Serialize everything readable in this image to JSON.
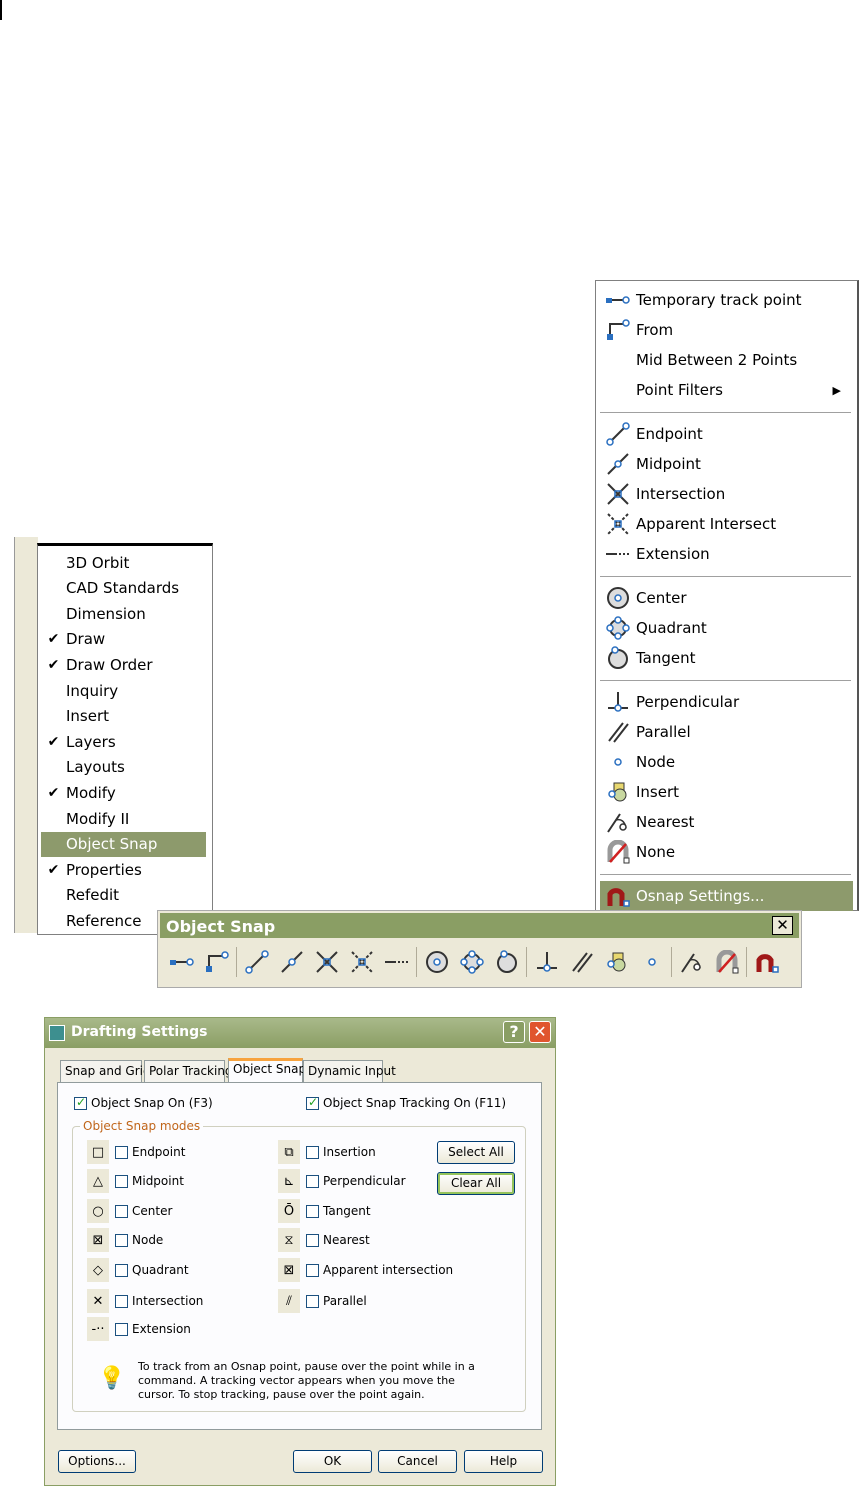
{
  "osnap_menu": {
    "items": [
      {
        "label": "Temporary track point",
        "icon": "temporary-track-point-icon"
      },
      {
        "label": "From",
        "icon": "from-icon"
      },
      {
        "label": "Mid Between 2 Points",
        "icon": ""
      },
      {
        "label": "Point Filters",
        "icon": "",
        "submenu": true
      },
      {
        "sep": true
      },
      {
        "label": "Endpoint",
        "icon": "endpoint-icon"
      },
      {
        "label": "Midpoint",
        "icon": "midpoint-icon"
      },
      {
        "label": "Intersection",
        "icon": "intersection-icon"
      },
      {
        "label": "Apparent Intersect",
        "icon": "apparent-intersect-icon"
      },
      {
        "label": "Extension",
        "icon": "extension-icon"
      },
      {
        "sep": true
      },
      {
        "label": "Center",
        "icon": "center-icon"
      },
      {
        "label": "Quadrant",
        "icon": "quadrant-icon"
      },
      {
        "label": "Tangent",
        "icon": "tangent-icon"
      },
      {
        "sep": true
      },
      {
        "label": "Perpendicular",
        "icon": "perpendicular-icon"
      },
      {
        "label": "Parallel",
        "icon": "parallel-icon"
      },
      {
        "label": "Node",
        "icon": "node-icon"
      },
      {
        "label": "Insert",
        "icon": "insert-icon"
      },
      {
        "label": "Nearest",
        "icon": "nearest-icon"
      },
      {
        "label": "None",
        "icon": "none-icon"
      },
      {
        "sep": true
      },
      {
        "label": "Osnap Settings...",
        "icon": "osnap-settings-icon",
        "highlighted": true
      }
    ]
  },
  "toolbar_menu": {
    "items": [
      {
        "label": "3D Orbit",
        "checked": false
      },
      {
        "label": "CAD Standards",
        "checked": false
      },
      {
        "label": "Dimension",
        "checked": false
      },
      {
        "label": "Draw",
        "checked": true
      },
      {
        "label": "Draw Order",
        "checked": true
      },
      {
        "label": "Inquiry",
        "checked": false
      },
      {
        "label": "Insert",
        "checked": false
      },
      {
        "label": "Layers",
        "checked": true
      },
      {
        "label": "Layouts",
        "checked": false
      },
      {
        "label": "Modify",
        "checked": true
      },
      {
        "label": "Modify II",
        "checked": false
      },
      {
        "label": "Object Snap",
        "checked": false,
        "highlighted": true
      },
      {
        "label": "Properties",
        "checked": true
      },
      {
        "label": "Refedit",
        "checked": false
      },
      {
        "label": "Reference",
        "checked": false
      }
    ]
  },
  "osnap_toolbar": {
    "title": "Object Snap",
    "close": "✕",
    "icons": [
      "temporary-track-point",
      "from",
      "|",
      "endpoint",
      "midpoint",
      "intersection",
      "apparent-intersect",
      "extension",
      "|",
      "center",
      "quadrant",
      "tangent",
      "|",
      "perpendicular",
      "parallel",
      "insert",
      "node",
      "|",
      "nearest",
      "none",
      "|",
      "osnap-settings"
    ]
  },
  "dialog": {
    "title": "Drafting Settings",
    "help": "?",
    "close": "✕",
    "tabs": [
      {
        "label": "Snap and Grid"
      },
      {
        "label": "Polar Tracking"
      },
      {
        "label": "Object Snap",
        "active": true
      },
      {
        "label": "Dynamic Input"
      }
    ],
    "osnap_on": {
      "label": "Object Snap On (F3)",
      "checked": true
    },
    "tracking_on": {
      "label": "Object Snap Tracking On (F11)",
      "checked": true
    },
    "group_label": "Object Snap modes",
    "modes_left": [
      {
        "label": "Endpoint",
        "glyph": "□"
      },
      {
        "label": "Midpoint",
        "glyph": "△"
      },
      {
        "label": "Center",
        "glyph": "○"
      },
      {
        "label": "Node",
        "glyph": "⊠"
      },
      {
        "label": "Quadrant",
        "glyph": "◇"
      },
      {
        "label": "Intersection",
        "glyph": "✕"
      },
      {
        "label": "Extension",
        "glyph": "-··"
      }
    ],
    "modes_right": [
      {
        "label": "Insertion",
        "glyph": "⧉"
      },
      {
        "label": "Perpendicular",
        "glyph": "⊾"
      },
      {
        "label": "Tangent",
        "glyph": "Ō"
      },
      {
        "label": "Nearest",
        "glyph": "⧖"
      },
      {
        "label": "Apparent intersection",
        "glyph": "⊠"
      },
      {
        "label": "Parallel",
        "glyph": "⫽"
      }
    ],
    "select_all": "Select All",
    "clear_all": "Clear All",
    "tip": "To track from an Osnap point, pause over the point while in a command.  A tracking vector appears when you move the cursor. To stop tracking, pause over the point again.",
    "buttons": {
      "options": "Options...",
      "ok": "OK",
      "cancel": "Cancel",
      "help": "Help"
    }
  }
}
